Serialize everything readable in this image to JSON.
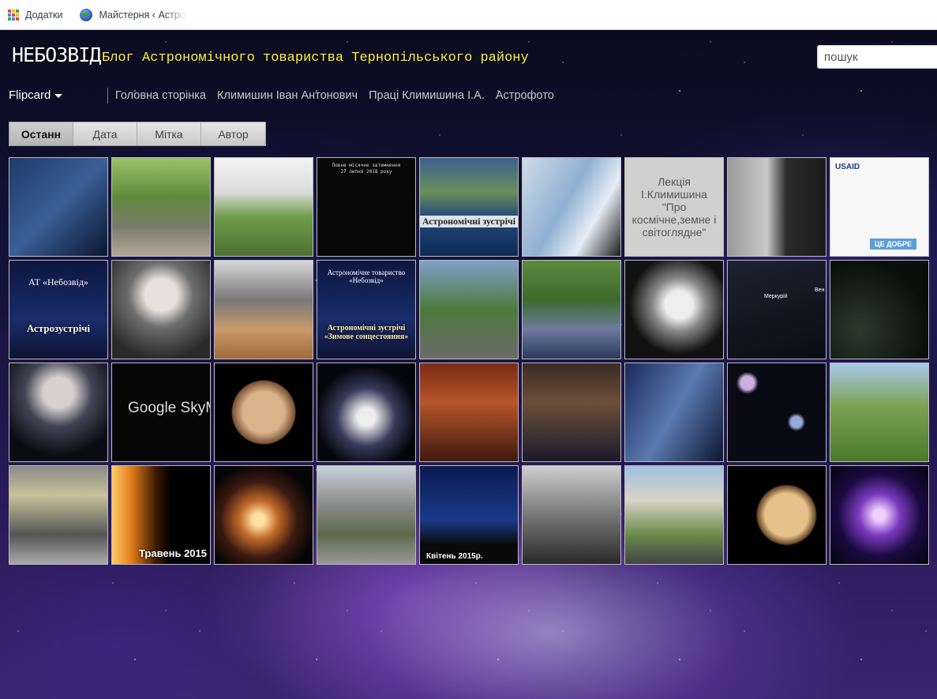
{
  "browser": {
    "bookmarks": [
      {
        "label": "Додатки",
        "icon": "apps-grid-icon"
      },
      {
        "label": "Майстерня ‹ АстроТ",
        "icon": "globe-icon"
      }
    ]
  },
  "blog": {
    "title": "НЕБОЗВІД",
    "description": "Блог Астрономічного товариства Тернопільського району"
  },
  "search": {
    "placeholder": "пошук"
  },
  "view_selector": {
    "label": "Flipcard"
  },
  "pages": [
    "Головна сторінка",
    "Климишин Іван Антонович",
    "Праці Климишина І.А.",
    "Астрофото"
  ],
  "tabs": [
    {
      "label": "Останн",
      "active": true
    },
    {
      "label": "Дата",
      "active": false
    },
    {
      "label": "Мітка",
      "active": false
    },
    {
      "label": "Автор",
      "active": false
    }
  ],
  "thumbnails": {
    "t4_lines": [
      "Повне місячне затемнення",
      "27 липня 2018 року"
    ],
    "t5_caption": "Астрономічні зустрічі",
    "t7_text": "Лекція І.Климишина \"Про космічне,земне і світоглядне\"",
    "t9_logo": "USAID",
    "t9_badge": "ЦЕ ДОБРЕ",
    "t10_title": "АТ «Небозвід»",
    "t10_caption": "Астрозустрічі",
    "t13_title": "Астрономічне товариство «Небозвід»",
    "t13_caption": "Астрономічні зустрічі «Зимове сонцестояння»",
    "t17_labels": [
      "Меркурій",
      "Вен"
    ],
    "t20_text": "Google SkyM",
    "t29_caption": "Травень 2015",
    "t32_caption": "Квітень 2015р."
  }
}
